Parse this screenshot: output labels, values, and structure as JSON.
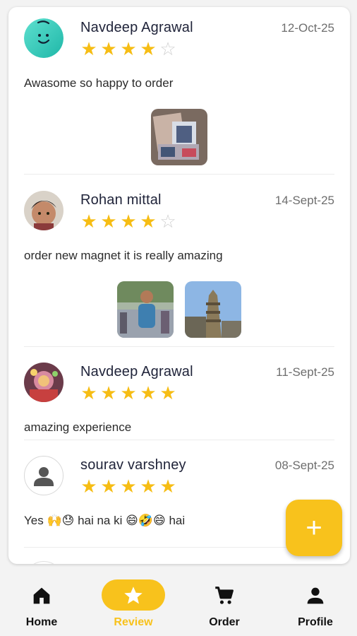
{
  "reviews": [
    {
      "name": "Navdeep Agrawal",
      "date": "12-Oct-25",
      "rating": 4,
      "text": "Awasome so happy to order",
      "photos": 1
    },
    {
      "name": "Rohan mittal",
      "date": "14-Sept-25",
      "rating": 4,
      "text": "order new magnet it is really amazing",
      "photos": 2
    },
    {
      "name": "Navdeep Agrawal",
      "date": "11-Sept-25",
      "rating": 5,
      "text": "amazing experience",
      "photos": 0
    },
    {
      "name": "sourav varshney",
      "date": "08-Sept-25",
      "rating": 5,
      "text": "Yes 🙌😓 hai na ki 😄🤣😄 hai",
      "photos": 0
    }
  ],
  "fab": {
    "label": "+"
  },
  "nav": {
    "items": [
      {
        "label": "Home",
        "icon": "home-icon"
      },
      {
        "label": "Review",
        "icon": "star-icon"
      },
      {
        "label": "Order",
        "icon": "cart-icon"
      },
      {
        "label": "Profile",
        "icon": "person-icon"
      }
    ],
    "active": "Review"
  },
  "colors": {
    "accent": "#f8c21c",
    "star": "#f6bd14",
    "star_empty": "#cfcfcf"
  }
}
